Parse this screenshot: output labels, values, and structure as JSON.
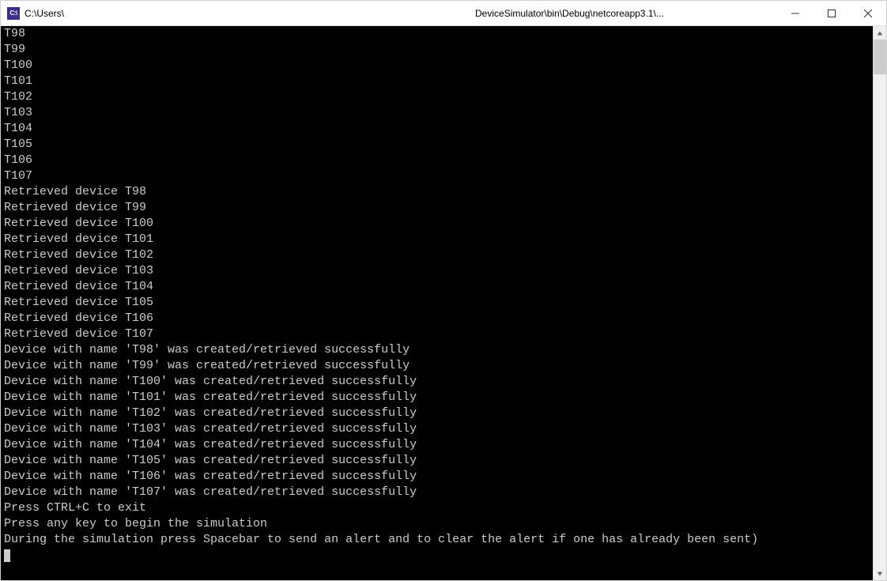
{
  "window": {
    "title_prefix": "C:\\Users\\",
    "title_suffix": "DeviceSimulator\\bin\\Debug\\netcoreapp3.1\\..."
  },
  "icon_text": "C:\\",
  "console": {
    "lines": [
      "T98",
      "T99",
      "T100",
      "T101",
      "T102",
      "T103",
      "T104",
      "T105",
      "T106",
      "T107",
      "Retrieved device T98",
      "Retrieved device T99",
      "Retrieved device T100",
      "Retrieved device T101",
      "Retrieved device T102",
      "Retrieved device T103",
      "Retrieved device T104",
      "Retrieved device T105",
      "Retrieved device T106",
      "Retrieved device T107",
      "Device with name 'T98' was created/retrieved successfully",
      "Device with name 'T99' was created/retrieved successfully",
      "Device with name 'T100' was created/retrieved successfully",
      "Device with name 'T101' was created/retrieved successfully",
      "Device with name 'T102' was created/retrieved successfully",
      "Device with name 'T103' was created/retrieved successfully",
      "Device with name 'T104' was created/retrieved successfully",
      "Device with name 'T105' was created/retrieved successfully",
      "Device with name 'T106' was created/retrieved successfully",
      "Device with name 'T107' was created/retrieved successfully",
      "Press CTRL+C to exit",
      "Press any key to begin the simulation",
      "During the simulation press Spacebar to send an alert and to clear the alert if one has already been sent)"
    ]
  }
}
